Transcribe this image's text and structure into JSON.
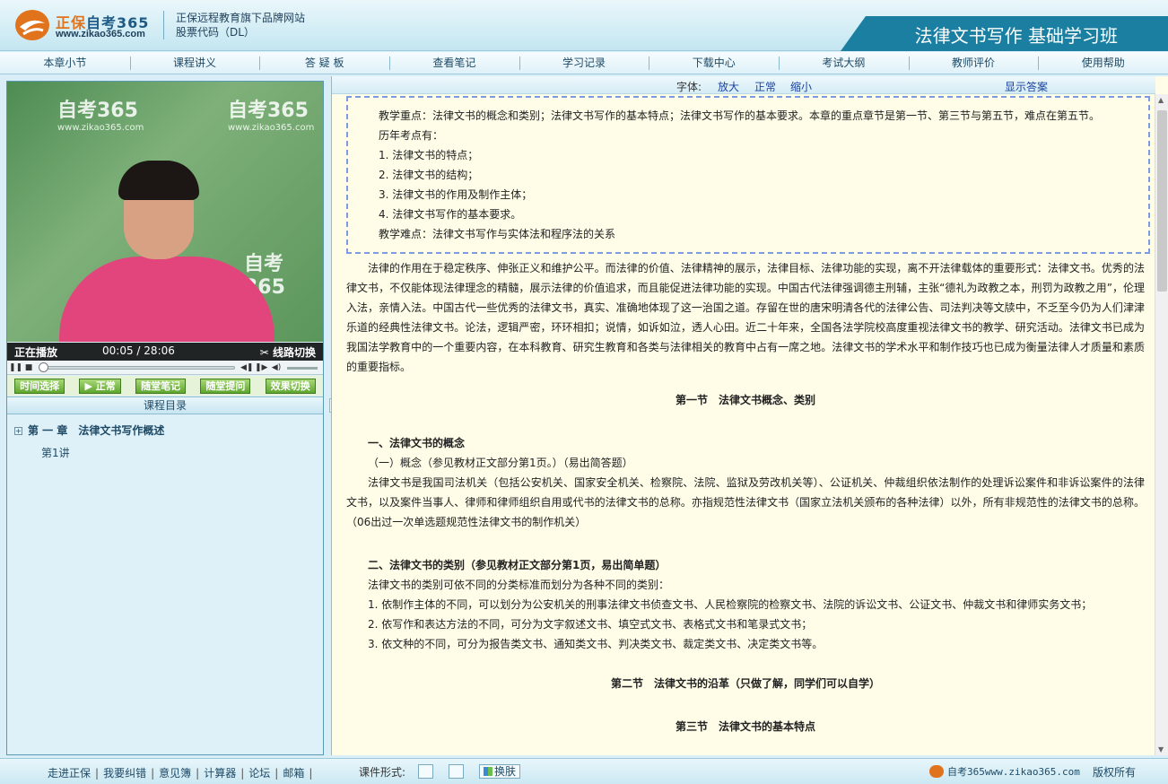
{
  "header": {
    "logo_brand": "正保",
    "logo_name": "自考365",
    "logo_url": "www.zikao365.com",
    "slogan_line1": "正保远程教育旗下品牌网站",
    "slogan_line2": "股票代码（DL）",
    "course_title": "法律文书写作 基础学习班"
  },
  "nav": [
    "本章小节",
    "课程讲义",
    "答 疑 板",
    "查看笔记",
    "学习记录",
    "下载中心",
    "考试大纲",
    "教师评价",
    "使用帮助"
  ],
  "video": {
    "watermark_text": "自考365",
    "watermark_url": "www.zikao365.com",
    "status": "正在播放",
    "current_time": "00:05",
    "time_sep": "/",
    "duration": "28:06",
    "switch_label": "线路切换",
    "progress_fraction": 0.003
  },
  "left_buttons": [
    "时间选择",
    "正常",
    "随堂笔记",
    "随堂提问",
    "效果切换"
  ],
  "catalog": {
    "header": "课程目录",
    "chapter": "第 一 章　法律文书写作概述",
    "lecture": "第1讲"
  },
  "fontbar": {
    "label": "字体:",
    "enlarge": "放大",
    "normal": "正常",
    "shrink": "缩小",
    "show_answer": "显示答案"
  },
  "keypoints": {
    "focus": "教学重点：法律文书的概念和类别；法律文书写作的基本特点；法律文书写作的基本要求。本章的重点章节是第一节、第三节与第五节，难点在第五节。",
    "history_title": "历年考点有：",
    "items": [
      "1. 法律文书的特点；",
      "2. 法律文书的结构；",
      "3. 法律文书的作用及制作主体；",
      "4. 法律文书写作的基本要求。"
    ],
    "difficulty": "教学难点：法律文书写作与实体法和程序法的关系"
  },
  "intro": "法律的作用在于稳定秩序、伸张正义和维护公平。而法律的价值、法律精神的展示，法律目标、法律功能的实现，离不开法律载体的重要形式：法律文书。优秀的法律文书，不仅能体现法律理念的精髓，展示法律的价值追求，而且能促进法律功能的实现。中国古代法律强调德主刑辅，主张“德礼为政教之本，刑罚为政教之用”，伦理入法，亲情入法。中国古代一些优秀的法律文书，真实、准确地体现了这一治国之道。存留在世的唐宋明清各代的法律公告、司法判决等文牍中，不乏至今仍为人们津津乐道的经典性法律文书。论法，逻辑严密，环环相扣；说情，如诉如泣，透人心田。近二十年来，全国各法学院校高度重视法律文书的教学、研究活动。法律文书已成为我国法学教育中的一个重要内容，在本科教育、研究生教育和各类与法律相关的教育中占有一席之地。法律文书的学术水平和制作技巧也已成为衡量法律人才质量和素质的重要指标。",
  "section1": {
    "title": "第一节　法律文书概念、类别",
    "sub1": "一、法律文书的概念",
    "sub1_note": "（一）概念（参见教材正文部分第1页。）（易出简答题）",
    "sub1_para": "法律文书是我国司法机关（包括公安机关、国家安全机关、检察院、法院、监狱及劳改机关等）、公证机关、仲裁组织依法制作的处理诉讼案件和非诉讼案件的法律文书，以及案件当事人、律师和律师组织自用或代书的法律文书的总称。亦指规范性法律文书（国家立法机关颁布的各种法律）以外，所有非规范性的法律文书的总称。（06出过一次单选题规范性法律文书的制作机关）",
    "sub2": "二、法律文书的类别（参见教材正文部分第1页，易出简单题）",
    "sub2_lead": "法律文书的类别可依不同的分类标准而划分为各种不同的类别：",
    "sub2_items": [
      "1. 依制作主体的不同，可以划分为公安机关的刑事法律文书侦查文书、人民检察院的检察文书、法院的诉讼文书、公证文书、仲裁文书和律师实务文书；",
      "2. 依写作和表达方法的不同，可分为文字叙述文书、填空式文书、表格式文书和笔录式文书；",
      "3. 依文种的不同，可分为报告类文书、通知类文书、判决类文书、裁定类文书、决定类文书等。"
    ]
  },
  "section2_title": "第二节　法律文书的沿革（只做了解，同学们可以自学）",
  "section3_title": "第三节　法律文书的基本特点",
  "footer": {
    "links": [
      "走进正保",
      "我要纠错",
      "意见簿",
      "计算器",
      "论坛",
      "邮箱"
    ],
    "mode_label": "课件形式:",
    "skin_label": "换肤",
    "brand": "自考365www.zikao365.com",
    "copyright": "版权所有"
  },
  "colors": {
    "accent": "#1b7fa2",
    "logo_orange": "#e0731c",
    "content_bg": "#fffde8",
    "button_green": "#5fa62f",
    "link_blue": "#1a44a0"
  }
}
